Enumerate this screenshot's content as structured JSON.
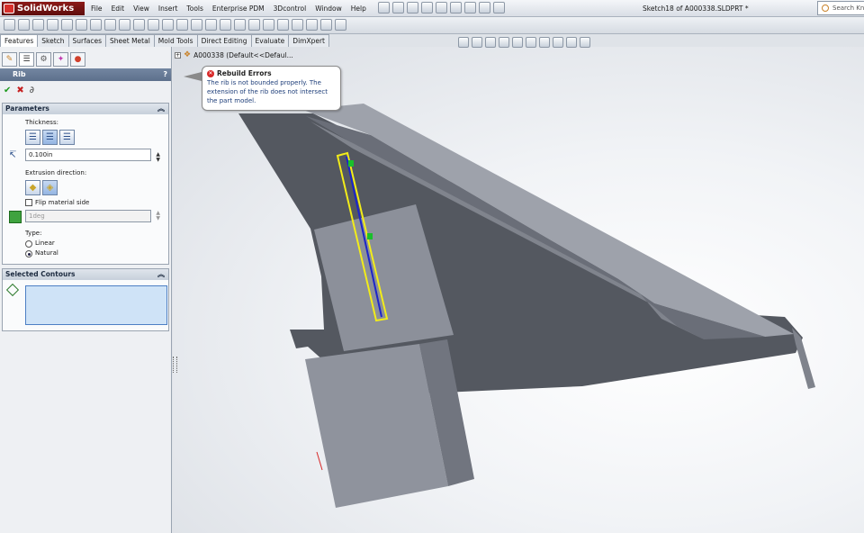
{
  "app": {
    "name": "SolidWorks",
    "document_title": "Sketch18 of A000338.SLDPRT *"
  },
  "menu": [
    "File",
    "Edit",
    "View",
    "Insert",
    "Tools",
    "Enterprise PDM",
    "3Dcontrol",
    "Window",
    "Help"
  ],
  "search": {
    "placeholder": "Search Kn"
  },
  "command_tabs": [
    "Features",
    "Sketch",
    "Surfaces",
    "Sheet Metal",
    "Mold Tools",
    "Direct Editing",
    "Evaluate",
    "DimXpert"
  ],
  "feature_tree": {
    "root": "A000338  (Default<<Defaul..."
  },
  "property_manager": {
    "title": "Rib",
    "help": "?",
    "parameters": {
      "header": "Parameters",
      "thickness_label": "Thickness:",
      "thickness_value": "0.100in",
      "extrusion_label": "Extrusion direction:",
      "flip_label": "Flip material side",
      "draft_value": "1deg",
      "type_label": "Type:",
      "type_options": [
        "Linear",
        "Natural"
      ],
      "type_selected": "Natural"
    },
    "contours": {
      "header": "Selected Contours"
    }
  },
  "tooltip": {
    "title": "Rebuild Errors",
    "body": "The rib is not bounded properly. The extension of the rib does not intersect the part model."
  },
  "colors": {
    "part_gray": "#8f949e",
    "sketch_blue": "#1c25c9",
    "preview_yellow": "#f2ec1a",
    "handle_green": "#19c02b",
    "error_red": "#d82828"
  }
}
